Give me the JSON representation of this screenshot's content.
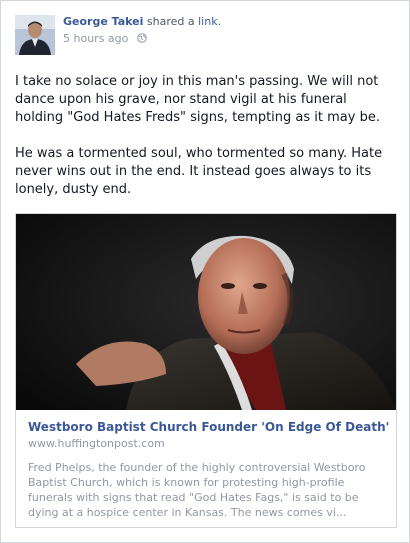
{
  "post": {
    "author": "George Takei",
    "action": "shared a",
    "object": "link",
    "period": ".",
    "time": "5 hours ago",
    "audience_icon": "globe-icon",
    "paragraphs": [
      "I take no solace or joy in this man's passing. We will not dance upon his grave, nor stand vigil at his funeral holding \"God Hates Freds\" signs, tempting as it may be.",
      "He was a tormented soul, who tormented so many. Hate never wins out in the end. It instead goes always to its lonely, dusty end."
    ]
  },
  "attachment": {
    "title": "Westboro Baptist Church Founder 'On Edge Of Death'",
    "domain": "www.huffingtonpost.com",
    "description": "Fred Phelps, the founder of the highly controversial Westboro Baptist Church, which is known for protesting high-profile funerals with signs that read \"God Hates Fags,\" is said to be dying at a hospice center in Kansas. The news comes vi..."
  },
  "colors": {
    "link_blue": "#3b5998",
    "muted_text": "#9197a3",
    "body_text": "#141823",
    "border": "#d3d6db"
  }
}
